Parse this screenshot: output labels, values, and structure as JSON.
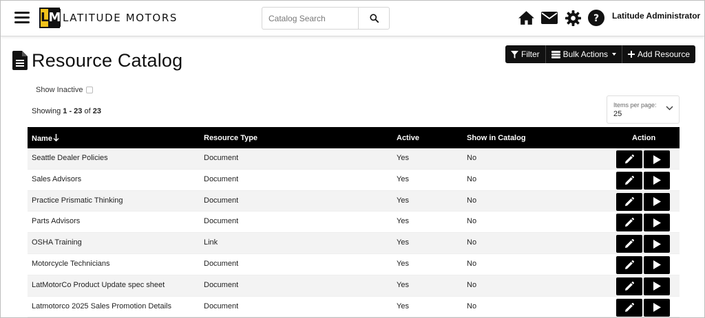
{
  "header": {
    "brand_text": "LATITUDE MOTORS",
    "logo_letters": {
      "left": "L",
      "right": "M"
    },
    "search_placeholder": "Catalog Search",
    "user_name": "Latitude Administrator",
    "icons": [
      "menu-icon",
      "search-icon",
      "home-icon",
      "mail-icon",
      "gear-icon",
      "help-icon"
    ]
  },
  "page": {
    "title": "Resource Catalog",
    "title_icon": "document-icon",
    "toolbar": {
      "filter_label": "Filter",
      "bulk_label": "Bulk Actions",
      "add_label": "Add Resource"
    },
    "show_inactive_label": "Show Inactive",
    "showing": {
      "prefix": "Showing ",
      "range": "1 - 23",
      "of": " of ",
      "total": "23"
    },
    "per_page": {
      "label": "Items per page:",
      "value": "25"
    }
  },
  "table": {
    "columns": {
      "name": "Name",
      "type": "Resource Type",
      "active": "Active",
      "catalog": "Show in Catalog",
      "action": "Action"
    },
    "rows": [
      {
        "name": "Seattle Dealer Policies",
        "type": "Document",
        "active": "Yes",
        "catalog": "No"
      },
      {
        "name": "Sales Advisors",
        "type": "Document",
        "active": "Yes",
        "catalog": "No"
      },
      {
        "name": "Practice Prismatic Thinking",
        "type": "Document",
        "active": "Yes",
        "catalog": "No"
      },
      {
        "name": "Parts Advisors",
        "type": "Document",
        "active": "Yes",
        "catalog": "No"
      },
      {
        "name": "OSHA Training",
        "type": "Link",
        "active": "Yes",
        "catalog": "No"
      },
      {
        "name": "Motorcycle Technicians",
        "type": "Document",
        "active": "Yes",
        "catalog": "No"
      },
      {
        "name": "LatMotorCo Product Update spec sheet",
        "type": "Document",
        "active": "Yes",
        "catalog": "No"
      },
      {
        "name": "Latmotorco 2025 Sales Promotion Details",
        "type": "Document",
        "active": "Yes",
        "catalog": "No"
      }
    ]
  },
  "colors": {
    "primary": "#000000",
    "logo_accent": "#f0c21b",
    "row_stripe": "#f3f3f3"
  }
}
